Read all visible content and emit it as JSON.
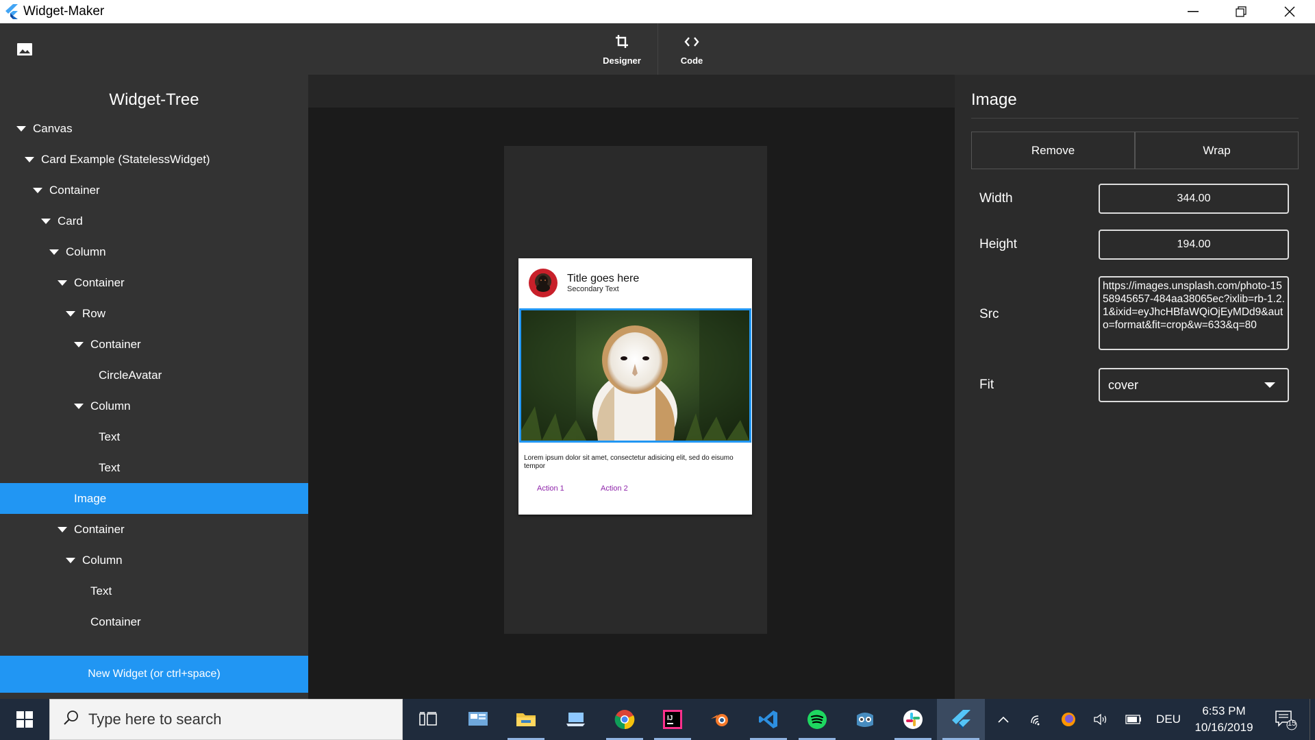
{
  "window": {
    "title": "Widget-Maker"
  },
  "toolbar": {
    "tabs": [
      {
        "label": "Designer",
        "icon": "crop-icon"
      },
      {
        "label": "Code",
        "icon": "code-icon"
      }
    ]
  },
  "sidebar": {
    "title": "Widget-Tree",
    "items": [
      {
        "label": "Canvas",
        "expanded": true
      },
      {
        "label": "Card Example (StatelessWidget)",
        "expanded": true
      },
      {
        "label": "Container",
        "expanded": true
      },
      {
        "label": "Card",
        "expanded": true
      },
      {
        "label": "Column",
        "expanded": true
      },
      {
        "label": "Container",
        "expanded": true
      },
      {
        "label": "Row",
        "expanded": true
      },
      {
        "label": "Container",
        "expanded": true
      },
      {
        "label": "CircleAvatar",
        "expanded": false
      },
      {
        "label": "Column",
        "expanded": true
      },
      {
        "label": "Text",
        "expanded": false
      },
      {
        "label": "Text",
        "expanded": false
      },
      {
        "label": "Image",
        "expanded": false,
        "selected": true
      },
      {
        "label": "Container",
        "expanded": true
      },
      {
        "label": "Column",
        "expanded": true
      },
      {
        "label": "Text",
        "expanded": false
      },
      {
        "label": "Container",
        "expanded": false
      }
    ],
    "new_widget_label": "New Widget (or ctrl+space)"
  },
  "preview": {
    "card_title": "Title goes here",
    "card_subtitle": "Secondary Text",
    "body_text": "Lorem ipsum dolor sit amet, consectetur adisicing elit, sed do eisumo tempor",
    "actions": [
      "Action 1",
      "Action 2"
    ]
  },
  "properties": {
    "title": "Image",
    "remove_label": "Remove",
    "wrap_label": "Wrap",
    "width_label": "Width",
    "width_value": "344.00",
    "height_label": "Height",
    "height_value": "194.00",
    "src_label": "Src",
    "src_value": "https://images.unsplash.com/photo-1558945657-484aa38065ec?ixlib=rb-1.2.1&ixid=eyJhcHBfaWQiOjEyMDd9&auto=format&fit=crop&w=633&q=80",
    "fit_label": "Fit",
    "fit_value": "cover"
  },
  "taskbar": {
    "search_placeholder": "Type here to search",
    "language": "DEU",
    "time": "6:53 PM",
    "date": "10/16/2019",
    "notification_count": "15"
  },
  "colors": {
    "accent": "#2196f3",
    "sidebar_bg": "#333333",
    "action_text": "#8e24aa"
  }
}
